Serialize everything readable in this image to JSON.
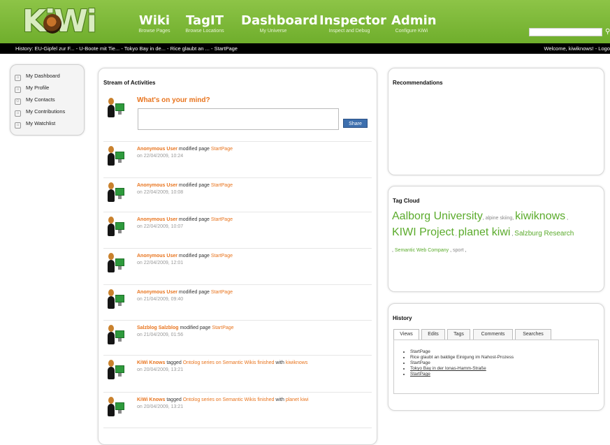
{
  "header": {
    "logo_text": "KiWi",
    "nav": [
      {
        "title": "Wiki",
        "subtitle": "Browse Pages"
      },
      {
        "title": "TagIT",
        "subtitle": "Browse Locations"
      },
      {
        "title": "Dashboard",
        "subtitle": "My Universe"
      },
      {
        "title": "Inspector",
        "subtitle": "Inspect and Debug"
      },
      {
        "title": "Admin",
        "subtitle": "Configure KiWi"
      }
    ],
    "search_value": ""
  },
  "history_bar": {
    "label": "History:",
    "items": [
      "EU-Gipfel zur F...",
      "U-Boote mit Tie...",
      "Tokyo Bay in de...",
      "Rice glaubt an ...",
      "StartPage"
    ],
    "separator": " - ",
    "welcome": "Welcome, kiwiknows! - Logo"
  },
  "sidebar": {
    "items": [
      {
        "label": "My Dashboard",
        "icon": "home-icon"
      },
      {
        "label": "My Profile",
        "icon": "home-icon"
      },
      {
        "label": "My Contacts",
        "icon": "contacts-icon"
      },
      {
        "label": "My Contributions",
        "icon": "home-icon"
      },
      {
        "label": "My Watchlist",
        "icon": "home-icon"
      }
    ]
  },
  "stream": {
    "title": "Stream of Activities",
    "prompt": "What's on your mind?",
    "input_value": "",
    "share_label": "Share",
    "activities": [
      {
        "user": "Anonymous User",
        "action": "modified page",
        "target": "StartPage",
        "date": "on 22/04/2009, 10:24"
      },
      {
        "user": "Anonymous User",
        "action": "modified page",
        "target": "StartPage",
        "date": "on 22/04/2009, 10:08"
      },
      {
        "user": "Anonymous User",
        "action": "modified page",
        "target": "StartPage",
        "date": "on 22/04/2009, 10:07"
      },
      {
        "user": "Anonymous User",
        "action": "modified page",
        "target": "StartPage",
        "date": "on 22/04/2009, 12:01"
      },
      {
        "user": "Anonymous User",
        "action": "modified page",
        "target": "StartPage",
        "date": "on 21/04/2009, 09:40"
      },
      {
        "user": "Salzblog Salzblog",
        "action": "modified page",
        "target": "StartPage",
        "date": "on 21/04/2009, 01:56"
      },
      {
        "user": "KiWi Knows",
        "action": "tagged",
        "target": "Ontolog series on Semantic Wikis finished",
        "extra_action": "with",
        "extra": "kiwiknows",
        "date": "on 20/04/2009, 13:21"
      },
      {
        "user": "KiWi Knows",
        "action": "tagged",
        "target": "Ontolog series on Semantic Wikis finished",
        "extra_action": "with",
        "extra": "planet kiwi",
        "date": "on 20/04/2009, 13:21"
      }
    ]
  },
  "recommendations": {
    "title": "Recommendations"
  },
  "tag_cloud": {
    "title": "Tag Cloud",
    "tags": [
      {
        "label": "Aalborg University",
        "weight": 3
      },
      {
        "label": "alpine skiing",
        "weight": 1
      },
      {
        "label": "kiwiknows",
        "weight": 3
      },
      {
        "label": "KIWI Project",
        "weight": 3
      },
      {
        "label": "planet kiwi",
        "weight": 3
      },
      {
        "label": "Salzburg Research",
        "weight": 2
      },
      {
        "label": "Semantic Web Company",
        "weight": 1
      },
      {
        "label": "sport",
        "weight": 1
      }
    ],
    "color": "#5bab2c"
  },
  "history_panel": {
    "title": "History",
    "tabs": [
      "Views",
      "Edits",
      "Tags",
      "Comments",
      "Searches"
    ],
    "active_tab": "Views",
    "items": [
      "StartPage",
      "Rice glaubt an baldige Einigung im Nahost-Prozess",
      "StartPage",
      "Tokyo Bay in der Ionas-Hamm-Straße",
      "StartPage"
    ]
  },
  "colors": {
    "header_green": "#7ab83a",
    "accent_orange": "#e8731c",
    "share_blue": "#3d6fae"
  }
}
